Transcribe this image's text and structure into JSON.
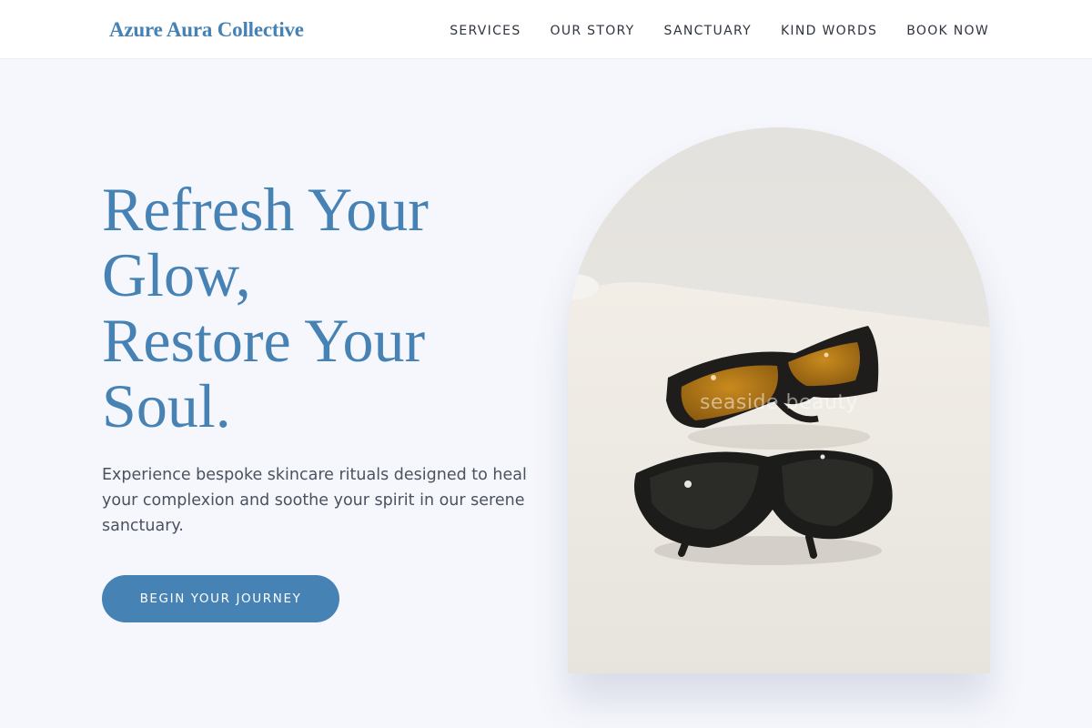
{
  "brand": {
    "name": "Azure Aura Collective",
    "accent_color": "#4682b4"
  },
  "nav": {
    "items": [
      {
        "label": "SERVICES"
      },
      {
        "label": "OUR STORY"
      },
      {
        "label": "SANCTUARY"
      },
      {
        "label": "KIND WORDS"
      },
      {
        "label": "BOOK NOW"
      }
    ]
  },
  "hero": {
    "title_lines": [
      "Refresh Your",
      "Glow,",
      "Restore Your",
      "Soul."
    ],
    "subtitle": "Experience bespoke skincare rituals designed to heal your complexion and soothe your spirit in our serene sanctuary.",
    "cta_label": "BEGIN YOUR JOURNEY",
    "image_watermark": "seaside beauty"
  }
}
